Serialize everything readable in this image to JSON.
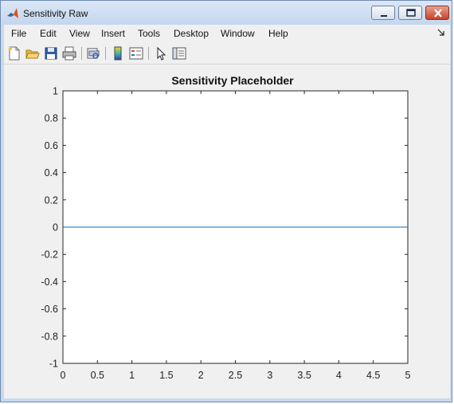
{
  "window": {
    "title": "Sensitivity Raw"
  },
  "menu": {
    "items": [
      "File",
      "Edit",
      "View",
      "Insert",
      "Tools",
      "Desktop",
      "Window",
      "Help"
    ]
  },
  "toolbar": {
    "icons": [
      "new-figure-icon",
      "open-file-icon",
      "save-icon",
      "print-icon",
      "print-preview-icon",
      "insert-colorbar-icon",
      "insert-legend-icon",
      "edit-plot-icon",
      "show-plot-tools-icon"
    ]
  },
  "colors": {
    "line": "#0072bd",
    "figure_bg": "#f0f0f0",
    "axes_bg": "#ffffff"
  },
  "chart_data": {
    "type": "line",
    "title": "Sensitivity Placeholder",
    "xlabel": "",
    "ylabel": "",
    "xlim": [
      0,
      5
    ],
    "ylim": [
      -1,
      1
    ],
    "xticks": [
      "0",
      "0.5",
      "1",
      "1.5",
      "2",
      "2.5",
      "3",
      "3.5",
      "4",
      "4.5",
      "5"
    ],
    "yticks": [
      "-1",
      "-0.8",
      "-0.6",
      "-0.4",
      "-0.2",
      "0",
      "0.2",
      "0.4",
      "0.6",
      "0.8",
      "1"
    ],
    "grid": false,
    "series": [
      {
        "x": [
          0,
          5
        ],
        "y": [
          0,
          0
        ]
      }
    ]
  }
}
